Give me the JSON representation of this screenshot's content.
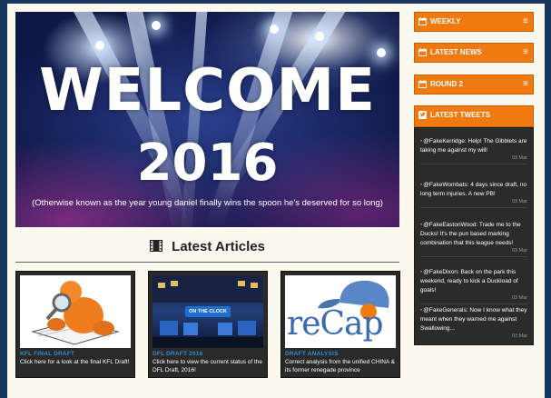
{
  "hero": {
    "title_line1": "WELCOME",
    "title_line2": "2016",
    "caption": "(Otherwise known as the year young daniel finally wins the spoon he's deserved for so long)"
  },
  "articles_heading": "Latest Articles",
  "articles": [
    {
      "title": "KFL FINAL DRAFT",
      "desc": "Click here for a look at the final KFL Draft!"
    },
    {
      "title": "DFL DRAFT 2016",
      "desc": "Click here to view the current status of the DFL Draft, 2016!",
      "thumb_text": "ON THE CLOCK"
    },
    {
      "title": "DRAFT ANALYSIS",
      "desc": "Correct analysis from the unified CHINA & its former renegade province",
      "thumb_text": "reCap"
    }
  ],
  "sidebar": {
    "weekly": "WEEKLY",
    "latest_news": "LATEST NEWS",
    "round": "ROUND 2",
    "latest_tweets": "LATEST TWEETS",
    "menu_glyph": "≡"
  },
  "tweets": [
    {
      "text": "@FakeKerridge: Help! The Gibblets are taking me against my will!",
      "date": "03 Mar"
    },
    {
      "text": "@FakeWombats: 4 days since draft, no long term injuries. A new PB!",
      "date": "03 Mar"
    },
    {
      "text": "@FakeEastonWood: Trade me to the Ducks! It's the pun based marking combination that this league needs!",
      "date": "03 Mar"
    },
    {
      "text": "@FakeDixon: Back on the park this weekend, ready to kick a Duckload of goals!",
      "date": "03 Mar"
    },
    {
      "text": "@FakeGenerals: Now I know what they meant when they warned me against Swallowing...",
      "date": "03 Mar"
    }
  ],
  "colors": {
    "accent": "#f07a10",
    "link": "#2d8fd0",
    "frame": "#17355f"
  }
}
